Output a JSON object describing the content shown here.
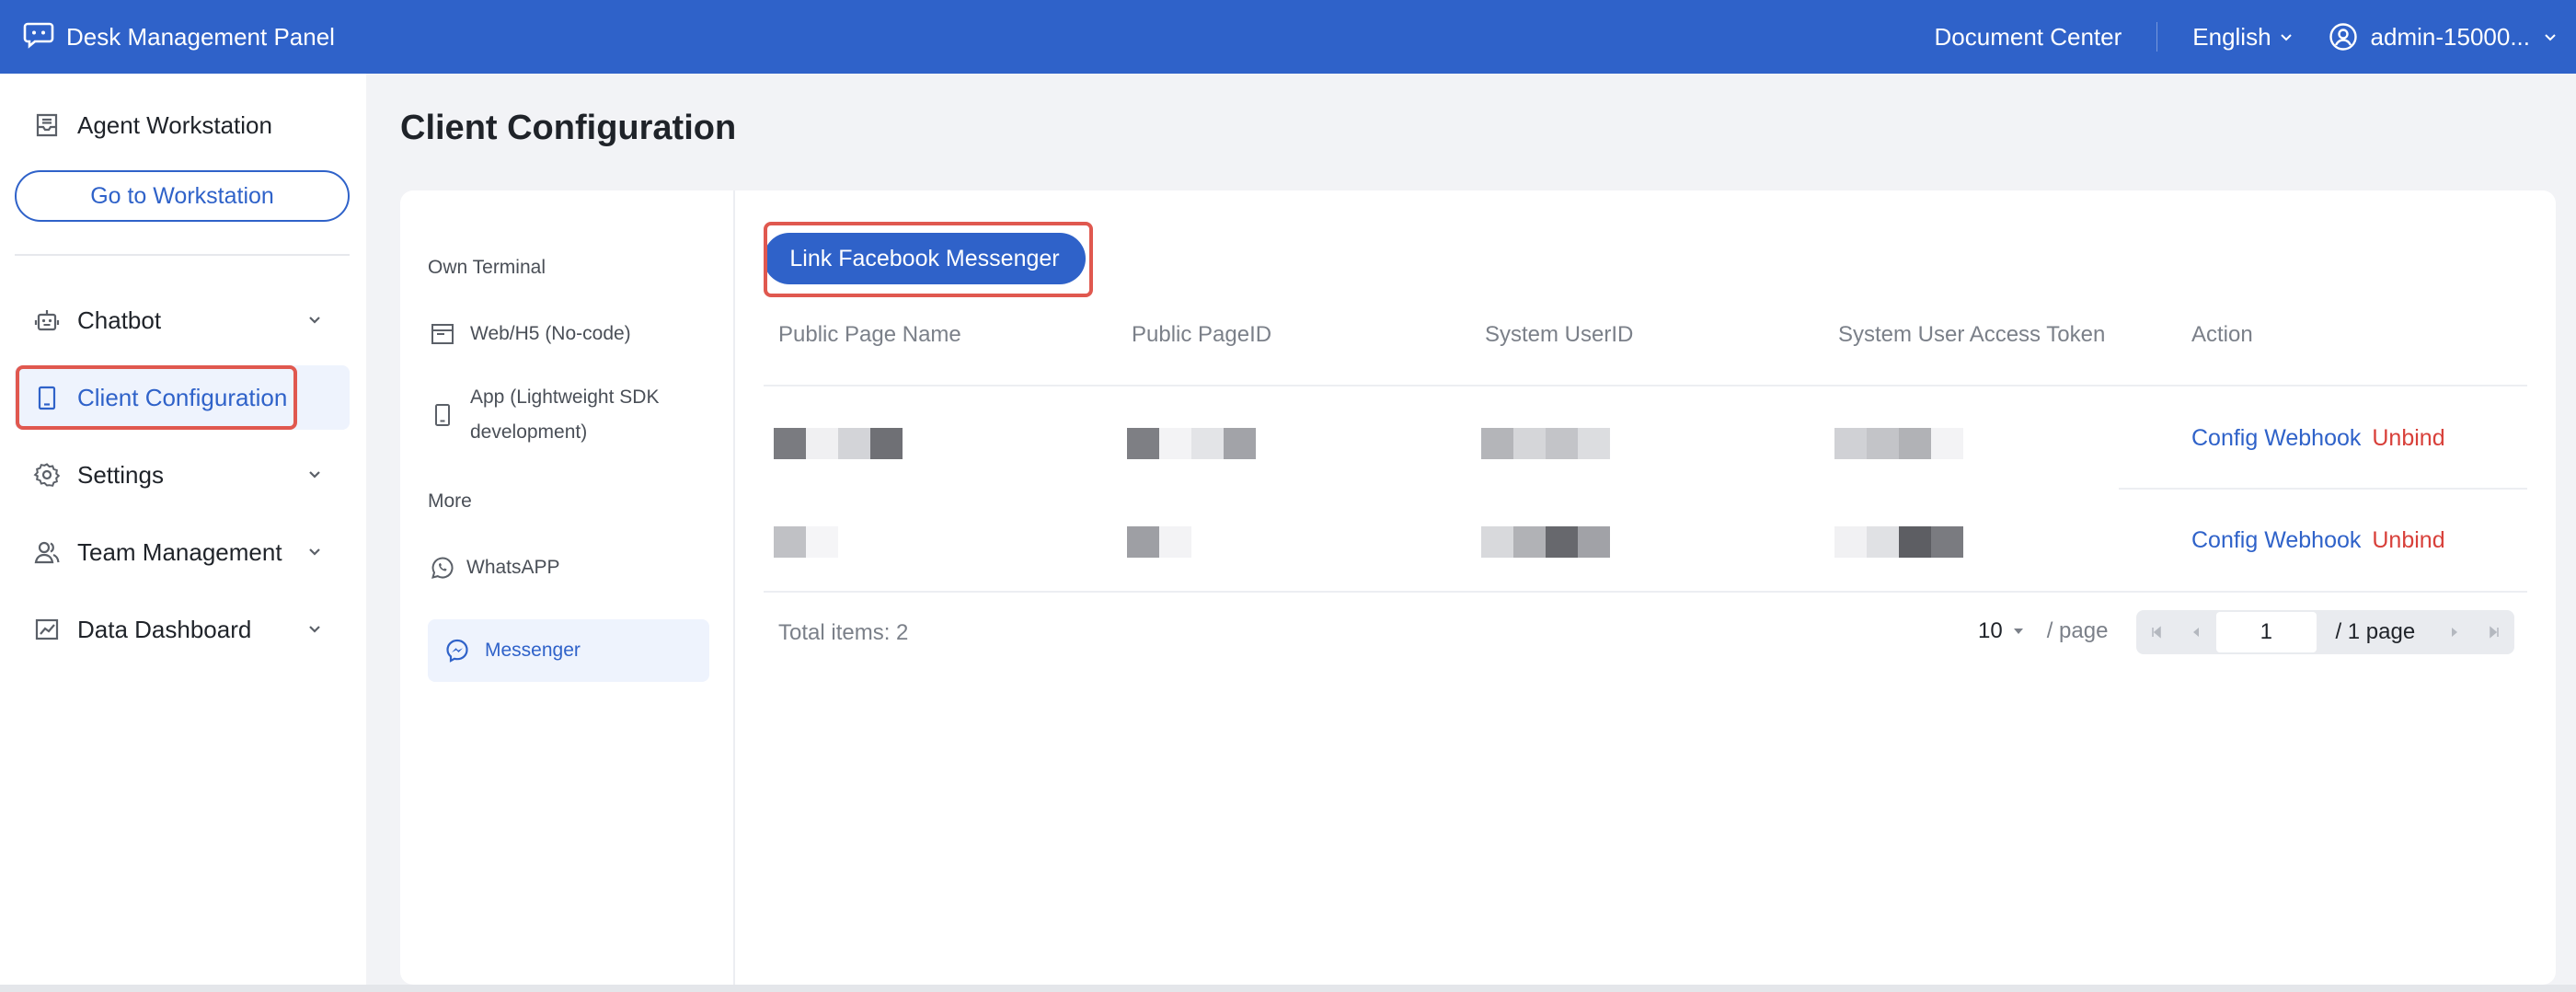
{
  "topbar": {
    "brand": "Desk Management Panel",
    "doc_center": "Document Center",
    "language": "English",
    "user": "admin-15000..."
  },
  "sidebar": {
    "workstation": "Agent Workstation",
    "goto_button": "Go to Workstation",
    "items": [
      {
        "label": "Chatbot",
        "icon": "robot-icon",
        "expandable": true
      },
      {
        "label": "Client Configuration",
        "icon": "tablet-icon",
        "expandable": false,
        "active": true
      },
      {
        "label": "Settings",
        "icon": "gear-icon",
        "expandable": true
      },
      {
        "label": "Team Management",
        "icon": "team-icon",
        "expandable": true
      },
      {
        "label": "Data Dashboard",
        "icon": "chart-icon",
        "expandable": true
      }
    ]
  },
  "main": {
    "title": "Client Configuration",
    "nav": {
      "own_terminal": "Own Terminal",
      "web": "Web/H5 (No-code)",
      "app_line1": "App (Lightweight SDK",
      "app_line2": "development)",
      "more": "More",
      "whatsapp": "WhatsAPP",
      "messenger": "Messenger"
    },
    "link_button": "Link Facebook Messenger",
    "table": {
      "headers": [
        "Public Page Name",
        "Public PageID",
        "System UserID",
        "System User Access Token",
        "Action"
      ],
      "rows": [
        {
          "config": "Config Webhook",
          "unbind": "Unbind"
        },
        {
          "config": "Config Webhook",
          "unbind": "Unbind"
        }
      ]
    },
    "footer": {
      "total_label": "Total items:",
      "total_value": "2",
      "page_size": "10",
      "page_size_unit": "/ page",
      "current_page": "1",
      "total_pages": "/ 1 page"
    }
  },
  "colors": {
    "brand_blue": "#2f62c9",
    "danger_red": "#d8403a",
    "highlight_red": "#e0584f"
  }
}
